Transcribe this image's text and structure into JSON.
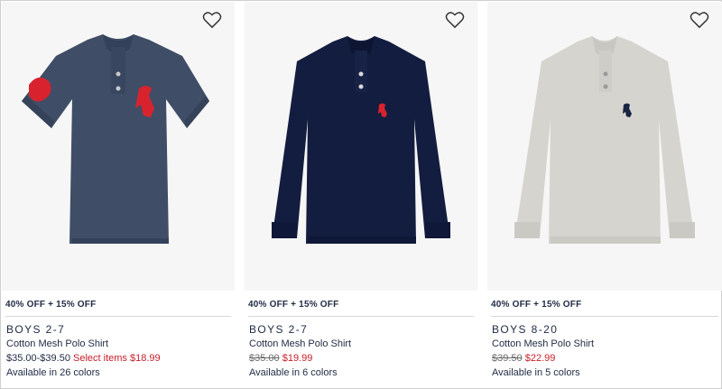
{
  "colors": {
    "text": "#1f2a44",
    "sale": "#c8202a",
    "heather_blue": "#3f4e66",
    "navy": "#131d3f",
    "grey": "#d6d4cf",
    "pony_red": "#d8232e",
    "pony_navy": "#1a2444"
  },
  "products": [
    {
      "promo": "40% OFF + 15% OFF",
      "category": "BOYS 2-7",
      "name": "Cotton Mesh Polo Shirt",
      "price_regular": "$35.00-$39.50",
      "price_sale": "Select items $18.99",
      "colors_available": "Available in 26 colors",
      "icon": "heart-icon"
    },
    {
      "promo": "40% OFF + 15% OFF",
      "category": "BOYS 2-7",
      "name": "Cotton Mesh Polo Shirt",
      "price_regular": "$35.00",
      "price_sale": "$19.99",
      "colors_available": "Available in 6 colors",
      "icon": "heart-icon"
    },
    {
      "promo": "40% OFF + 15% OFF",
      "category": "BOYS 8-20",
      "name": "Cotton Mesh Polo Shirt",
      "price_regular": "$39.50",
      "price_sale": "$22.99",
      "colors_available": "Available in 5 colors",
      "icon": "heart-icon"
    }
  ]
}
